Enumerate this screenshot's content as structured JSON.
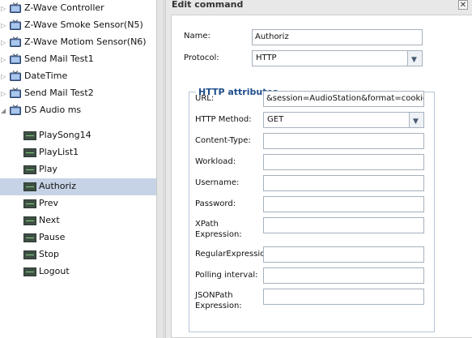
{
  "tree": {
    "devices": [
      {
        "label": "Z-Wave Controller"
      },
      {
        "label": "Z-Wave Smoke Sensor(N5)"
      },
      {
        "label": "Z-Wave Motiom Sensor(N6)"
      },
      {
        "label": "Send Mail Test1"
      },
      {
        "label": "DateTime"
      },
      {
        "label": "Send Mail Test2"
      },
      {
        "label": "DS Audio ms"
      }
    ],
    "commands": [
      {
        "label": "PlaySong14"
      },
      {
        "label": "PlayList1"
      },
      {
        "label": "Play"
      },
      {
        "label": "Authoriz",
        "selected": true
      },
      {
        "label": "Prev"
      },
      {
        "label": "Next"
      },
      {
        "label": "Pause"
      },
      {
        "label": "Stop"
      },
      {
        "label": "Logout"
      }
    ]
  },
  "dialog": {
    "title": "Edit command",
    "close_glyph": "✕",
    "name_label": "Name:",
    "name_value": "Authoriz",
    "protocol_label": "Protocol:",
    "protocol_value": "HTTP",
    "http": {
      "legend": "HTTP attributes",
      "url_label": "URL:",
      "url_value": "&session=AudioStation&format=cookie",
      "method_label": "HTTP Method:",
      "method_value": "GET",
      "content_type_label": "Content-Type:",
      "content_type_value": "",
      "workload_label": "Workload:",
      "workload_value": "",
      "username_label": "Username:",
      "username_value": "",
      "password_label": "Password:",
      "password_value": "",
      "xpath_label_1": "XPath",
      "xpath_label_2": "Expression:",
      "xpath_value": "",
      "regex_label": "RegularExpression:",
      "regex_value": "",
      "polling_label": "Polling interval:",
      "polling_value": "",
      "jsonpath_label_1": "JSONPath",
      "jsonpath_label_2": "Expression:",
      "jsonpath_value": ""
    }
  },
  "icons": {
    "expand": "▷",
    "collapse": "◢",
    "dropdown": "▼"
  },
  "colors": {
    "selection": "#c6d3e6",
    "legend": "#1f4e8c"
  }
}
